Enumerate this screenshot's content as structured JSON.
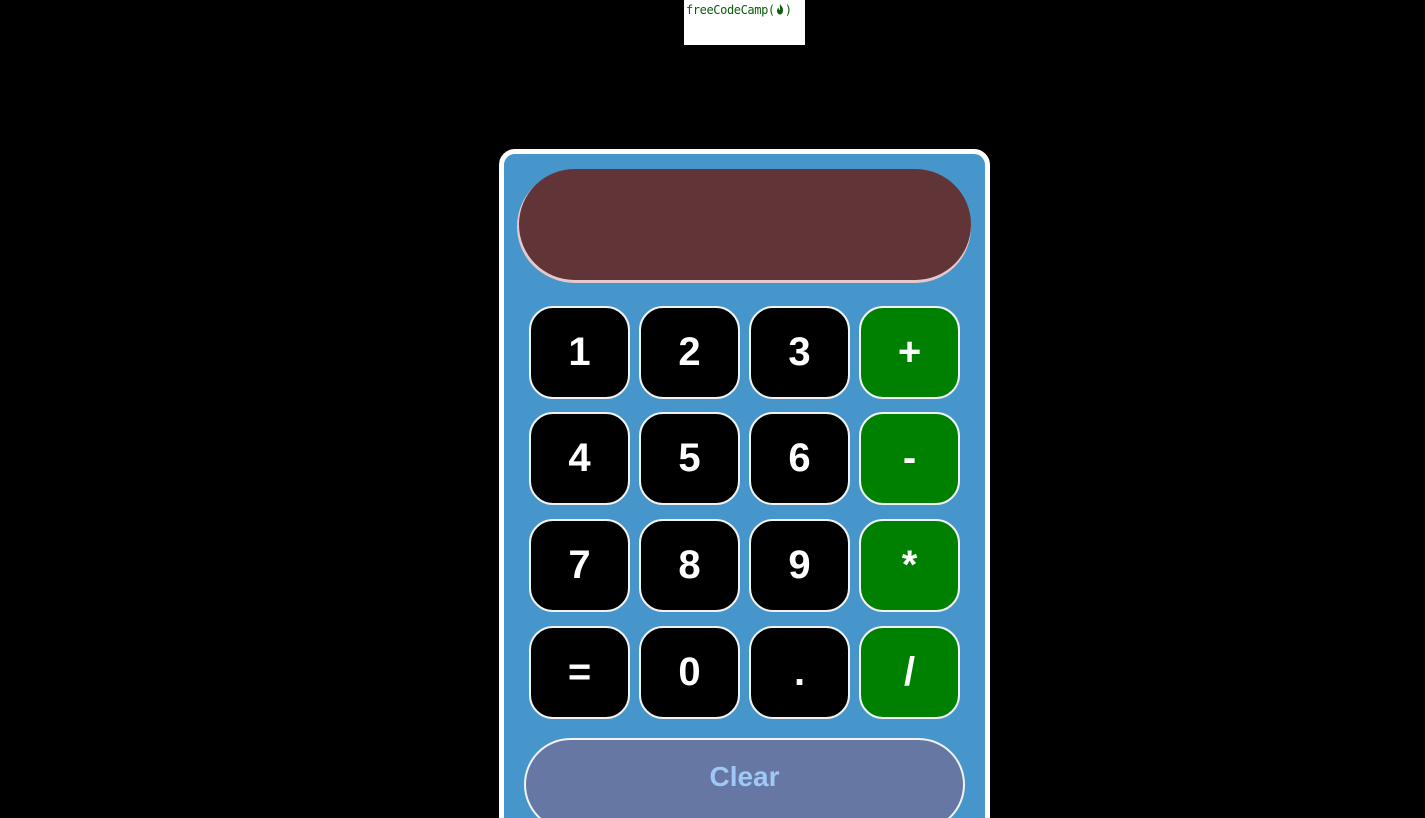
{
  "banner": {
    "text": "freeCodeCamp(",
    "close": ")"
  },
  "display": {
    "value": ""
  },
  "keypad": {
    "rows": [
      [
        {
          "label": "1",
          "kind": "num"
        },
        {
          "label": "2",
          "kind": "num"
        },
        {
          "label": "3",
          "kind": "num"
        },
        {
          "label": "+",
          "kind": "op"
        }
      ],
      [
        {
          "label": "4",
          "kind": "num"
        },
        {
          "label": "5",
          "kind": "num"
        },
        {
          "label": "6",
          "kind": "num"
        },
        {
          "label": "-",
          "kind": "op"
        }
      ],
      [
        {
          "label": "7",
          "kind": "num"
        },
        {
          "label": "8",
          "kind": "num"
        },
        {
          "label": "9",
          "kind": "num"
        },
        {
          "label": "*",
          "kind": "op"
        }
      ],
      [
        {
          "label": "=",
          "kind": "num"
        },
        {
          "label": "0",
          "kind": "num"
        },
        {
          "label": ".",
          "kind": "num"
        },
        {
          "label": "/",
          "kind": "op"
        }
      ]
    ]
  },
  "clear": {
    "label": "Clear"
  },
  "colors": {
    "page_background": "#000000",
    "calculator_body": "#4796cb",
    "display_background": "#613537",
    "number_key": "#000000",
    "operator_key": "#008000",
    "clear_button": "#6677a3",
    "clear_text": "#9ec8f5",
    "banner_text": "#0a5c0a"
  },
  "icons": {
    "banner_logo": "fire-icon"
  }
}
